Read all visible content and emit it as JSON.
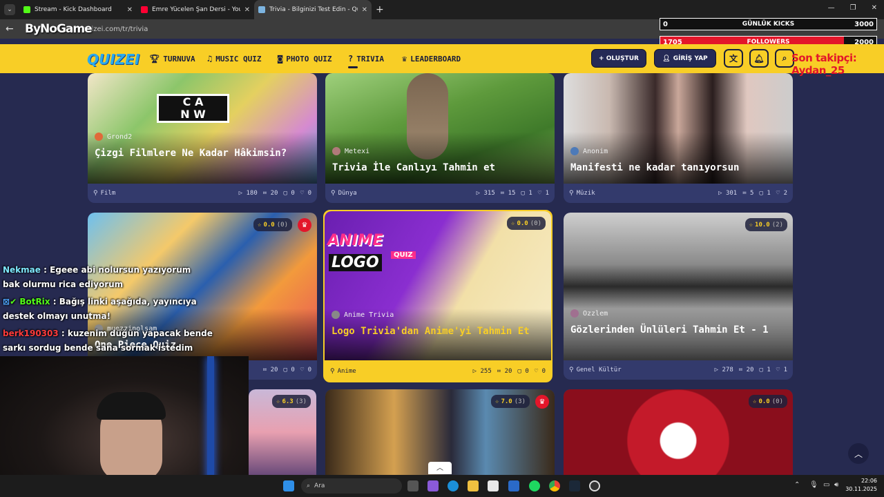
{
  "browser": {
    "tabs": [
      {
        "title": "Stream - Kick Dashboard",
        "favicon_color": "#53fc18"
      },
      {
        "title": "Emre Yücelen Şan Dersi - YouTu",
        "favicon_color": "#ff0033"
      },
      {
        "title": "Trivia - Bilginizi Test Edin - Quiz",
        "favicon_color": "#7cb4e0"
      }
    ],
    "url": "quizei.com/tr/trivia",
    "watermark": "ByNoGame"
  },
  "overlay": {
    "kicks": {
      "value": "0",
      "label": "GÜNLÜK KICKS",
      "goal": "3000"
    },
    "followers": {
      "value": "1705",
      "label": "FOLLOWERS",
      "goal": "2000"
    },
    "last_follower": "Son takipçi: Aydan_25"
  },
  "site": {
    "logo": "QUIZEI",
    "nav": [
      {
        "label": "TURNUVA",
        "icon": "trophy-icon"
      },
      {
        "label": "MUSIC QUIZ",
        "icon": "music-note-icon"
      },
      {
        "label": "PHOTO QUIZ",
        "icon": "camera-icon"
      },
      {
        "label": "TRIVIA",
        "icon": "chat-question-icon"
      },
      {
        "label": "LEADERBOARD",
        "icon": "cup-icon"
      }
    ],
    "create_label": "+ OLUŞTUR",
    "login_label": "GİRİŞ YAP"
  },
  "cards": [
    {
      "author": "Grond2",
      "title": "Çizgi Filmlere Ne Kadar Hâkimsin?",
      "category": "Film",
      "plays": "180",
      "questions": "20",
      "comments": "0",
      "likes": "0"
    },
    {
      "author": "Metexi",
      "title": "Trivia İle Canlıyı Tahmin et",
      "category": "Dünya",
      "plays": "315",
      "questions": "15",
      "comments": "1",
      "likes": "1"
    },
    {
      "author": "Anonim",
      "title": "Manifesti ne kadar tanıyorsun",
      "category": "Müzik",
      "plays": "301",
      "questions": "5",
      "comments": "1",
      "likes": "2"
    },
    {
      "author": "muezzinolsam",
      "title": "One Piece Quiz",
      "rating": "0.0",
      "rating_count": "(0)",
      "questions": "20",
      "comments": "0",
      "likes": "0"
    },
    {
      "author": "Anime Trivia",
      "title": "Logo Trivia'dan Anime'yi Tahmin Et",
      "rating": "0.0",
      "rating_count": "(0)",
      "category": "Anime",
      "plays": "255",
      "questions": "20",
      "comments": "0",
      "likes": "0",
      "image_text_1": "ANIME",
      "image_text_2": "LOGO",
      "image_text_3": "QUIZ"
    },
    {
      "author": "Ozzlem",
      "title": "Gözlerinden Ünlüleri Tahmin Et - 1",
      "rating": "10.0",
      "rating_count": "(2)",
      "category": "Genel Kültür",
      "plays": "278",
      "questions": "20",
      "comments": "1",
      "likes": "1"
    },
    {
      "rating": "6.3",
      "rating_count": "(3)"
    },
    {
      "rating": "7.0",
      "rating_count": "(3)"
    },
    {
      "rating": "0.0",
      "rating_count": "(0)"
    }
  ],
  "chat": [
    {
      "user": "Nekmae",
      "user_color": "#7fe9ff",
      "text": ": Egeee abi nolursun yazıyorum bak olurmu rica ediyorum"
    },
    {
      "user": "BotRix",
      "user_color": "#53fc18",
      "text": ": Bağış linki aşağıda, yayıncıya destek olmayı unutma!"
    },
    {
      "user": "berk190303",
      "user_color": "#ff3b3b",
      "text": ": kuzenim düğün yapacak bende sarkı sordug bende sana sormak istedim"
    }
  ],
  "taskbar": {
    "search_label": "Ara",
    "time": "22:06",
    "date": "30.11.2025"
  }
}
